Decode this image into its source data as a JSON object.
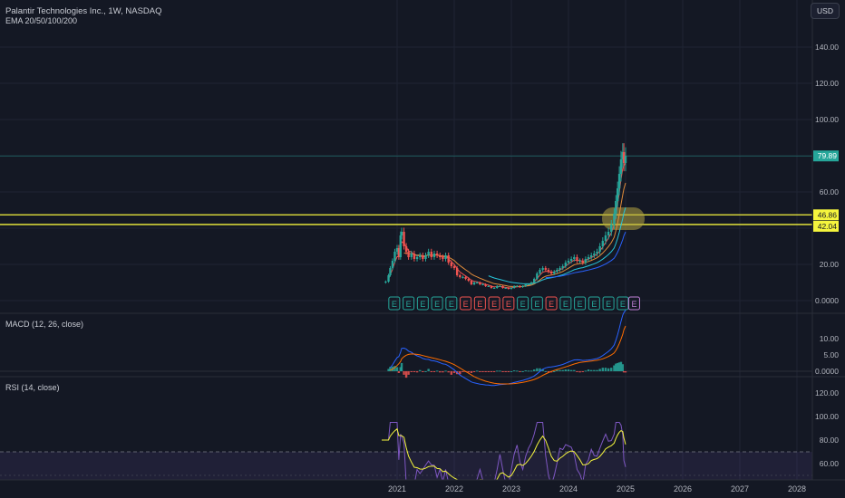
{
  "header": {
    "symbol_line": "Palantir Technologies Inc., 1W, NASDAQ",
    "indicator_line": "EMA 20/50/100/200",
    "currency": "USD"
  },
  "price_pane": {
    "y_ticks": [
      "140.00",
      "120.00",
      "100.00",
      "80.00",
      "60.00",
      "40.00",
      "20.00",
      "0.0000"
    ],
    "last_price": "79.89",
    "level_upper": "46.86",
    "level_lower": "42.04",
    "earnings_markers": [
      {
        "year": 2020.95,
        "kind": "beat",
        "label": "E"
      },
      {
        "year": 2021.2,
        "kind": "beat",
        "label": "E"
      },
      {
        "year": 2021.45,
        "kind": "beat",
        "label": "E"
      },
      {
        "year": 2021.7,
        "kind": "beat",
        "label": "E"
      },
      {
        "year": 2021.95,
        "kind": "beat",
        "label": "E"
      },
      {
        "year": 2022.2,
        "kind": "miss",
        "label": "E"
      },
      {
        "year": 2022.45,
        "kind": "miss",
        "label": "E"
      },
      {
        "year": 2022.7,
        "kind": "miss",
        "label": "E"
      },
      {
        "year": 2022.95,
        "kind": "miss",
        "label": "E"
      },
      {
        "year": 2023.2,
        "kind": "beat",
        "label": "E"
      },
      {
        "year": 2023.45,
        "kind": "beat",
        "label": "E"
      },
      {
        "year": 2023.7,
        "kind": "miss",
        "label": "E"
      },
      {
        "year": 2023.95,
        "kind": "beat",
        "label": "E"
      },
      {
        "year": 2024.2,
        "kind": "beat",
        "label": "E"
      },
      {
        "year": 2024.45,
        "kind": "beat",
        "label": "E"
      },
      {
        "year": 2024.7,
        "kind": "beat",
        "label": "E"
      },
      {
        "year": 2024.95,
        "kind": "beat",
        "label": "E"
      },
      {
        "year": 2025.15,
        "kind": "upcoming",
        "label": "E"
      }
    ]
  },
  "macd_pane": {
    "title": "MACD (12, 26, close)",
    "y_ticks": [
      "10.00",
      "5.00",
      "0.0000"
    ]
  },
  "rsi_pane": {
    "title": "RSI (14, close)",
    "y_ticks": [
      "120.00",
      "100.00",
      "80.00",
      "60.00"
    ]
  },
  "x_axis": [
    "2021",
    "2022",
    "2023",
    "2024",
    "2025",
    "2026",
    "2027",
    "2028"
  ],
  "colors": {
    "background": "#141824",
    "up": "#26a69a",
    "down": "#ef5350",
    "level_line": "#f5f53d",
    "highlight": "#b5a543",
    "ema20": "#ef5350",
    "ema50": "#e08b3a",
    "ema100": "#26c6da",
    "ema200": "#2962ff",
    "macd_line": "#2962ff",
    "signal_line": "#ff6d00",
    "rsi_line": "#7e57c2",
    "rsi_ma": "#f5f53d"
  },
  "chart_data": {
    "type": "line",
    "title": "Palantir Technologies Inc., 1W, NASDAQ",
    "price": {
      "x": [
        2020.73,
        2020.8,
        2020.85,
        2020.88,
        2020.92,
        2020.96,
        2021.0,
        2021.03,
        2021.06,
        2021.08,
        2021.12,
        2021.16,
        2021.2,
        2021.25,
        2021.3,
        2021.35,
        2021.4,
        2021.45,
        2021.5,
        2021.55,
        2021.6,
        2021.65,
        2021.7,
        2021.75,
        2021.8,
        2021.85,
        2021.9,
        2021.95,
        2022.0,
        2022.05,
        2022.1,
        2022.15,
        2022.2,
        2022.25,
        2022.3,
        2022.35,
        2022.4,
        2022.45,
        2022.5,
        2022.55,
        2022.6,
        2022.65,
        2022.7,
        2022.75,
        2022.8,
        2022.85,
        2022.9,
        2022.95,
        2023.0,
        2023.05,
        2023.1,
        2023.15,
        2023.2,
        2023.25,
        2023.3,
        2023.35,
        2023.4,
        2023.45,
        2023.5,
        2023.55,
        2023.6,
        2023.65,
        2023.7,
        2023.75,
        2023.8,
        2023.85,
        2023.9,
        2023.95,
        2024.0,
        2024.05,
        2024.1,
        2024.15,
        2024.2,
        2024.25,
        2024.3,
        2024.35,
        2024.4,
        2024.45,
        2024.5,
        2024.55,
        2024.6,
        2024.65,
        2024.7,
        2024.75,
        2024.8,
        2024.83,
        2024.86,
        2024.89,
        2024.92,
        2024.95,
        2024.97,
        2025.0
      ],
      "close": [
        10,
        10.5,
        14,
        18,
        22,
        27,
        29,
        24,
        36,
        38,
        30,
        27,
        24,
        26,
        23,
        24,
        25,
        23,
        25,
        27,
        24,
        26,
        25,
        24,
        23,
        25,
        21,
        19,
        18,
        14,
        13,
        13,
        12,
        11,
        9,
        10,
        10,
        9,
        9,
        8,
        8,
        7,
        7,
        8,
        8,
        7,
        7,
        6.5,
        7,
        8,
        8,
        7.5,
        8,
        9,
        9,
        10,
        12,
        15,
        17,
        18,
        17,
        16,
        15,
        16,
        17,
        18,
        19,
        21,
        22,
        23,
        24,
        22,
        22,
        21,
        23,
        24,
        25,
        26,
        27,
        30,
        33,
        36,
        38,
        42,
        48,
        55,
        62,
        70,
        78,
        82,
        76,
        79.89
      ],
      "last": 79.89,
      "ylim": [
        0,
        150
      ]
    },
    "horizontal_levels": [
      46.86,
      42.04
    ],
    "ema_labels": [
      "EMA 20",
      "EMA 50",
      "EMA 100",
      "EMA 200"
    ],
    "macd": {
      "title": "MACD (12, 26, close)",
      "ylim": [
        -1,
        16
      ]
    },
    "rsi": {
      "title": "RSI (14, close)",
      "band": [
        30,
        70
      ],
      "ylim": [
        40,
        130
      ]
    },
    "x_ticks": [
      "2021",
      "2022",
      "2023",
      "2024",
      "2025",
      "2026",
      "2027",
      "2028"
    ]
  }
}
